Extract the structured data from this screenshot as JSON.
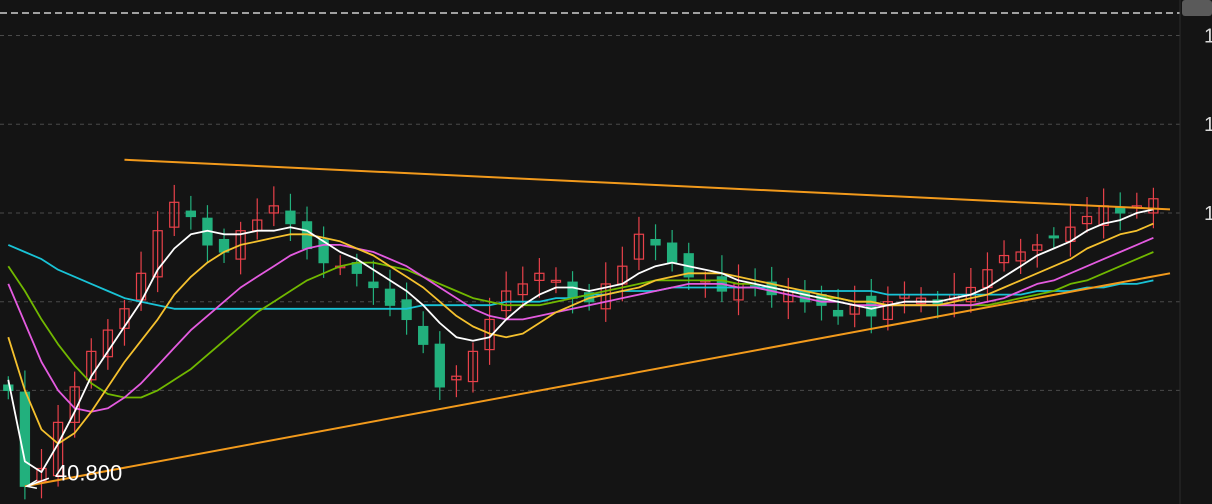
{
  "chart_data": {
    "type": "candlestick",
    "grid": true,
    "grid_style": "dashed",
    "ylim": [
      40.3,
      54.5
    ],
    "gridlines_y": [
      53.5,
      51.0,
      48.5,
      46.0,
      43.5
    ],
    "y_tick_labels": [
      {
        "y": 53.5,
        "text": "1"
      },
      {
        "y": 51.0,
        "text": "1"
      },
      {
        "y": 48.5,
        "text": "1"
      }
    ],
    "annotations": [
      {
        "type": "low_marker",
        "index": 1,
        "value": 40.8,
        "text": "40.800"
      }
    ],
    "trendlines": [
      {
        "name": "upper-resistance",
        "color": "#f29a1c",
        "from": {
          "x": 7,
          "y": 50.0
        },
        "to": {
          "x": 100,
          "y": 48.6
        }
      },
      {
        "name": "lower-support",
        "color": "#f29a1c",
        "from": {
          "x": 1,
          "y": 40.8
        },
        "to": {
          "x": 100,
          "y": 46.8
        }
      }
    ],
    "colors": {
      "up": "#e8414a",
      "down": "#22b07d",
      "background": "#141414",
      "grid": "#4a4a4a",
      "trend": "#f29a1c",
      "ma5": "#ffffff",
      "ma10": "#f5c12e",
      "ma20": "#e45be0",
      "ma30": "#71b800",
      "ma60": "#19c3d6"
    },
    "closes": [
      43.5,
      40.8,
      41.3,
      42.6,
      43.6,
      44.6,
      45.2,
      45.8,
      46.8,
      48.0,
      48.8,
      48.4,
      47.6,
      47.4,
      48.0,
      48.3,
      48.7,
      48.2,
      47.5,
      47.1,
      47.0,
      46.8,
      46.4,
      45.9,
      45.5,
      44.8,
      43.6,
      43.9,
      44.6,
      45.5,
      46.3,
      46.5,
      46.8,
      46.6,
      46.1,
      46.0,
      46.5,
      47.0,
      47.9,
      47.6,
      47.1,
      46.7,
      46.6,
      46.3,
      46.5,
      46.4,
      46.2,
      46.3,
      46.0,
      45.9,
      45.6,
      45.9,
      45.6,
      46.0,
      46.2,
      46.1,
      45.9,
      46.2,
      46.4,
      46.9,
      47.3,
      47.4,
      47.6,
      47.8,
      48.1,
      48.4,
      48.7,
      48.5,
      48.7,
      48.9
    ],
    "ma5": [
      43.8,
      41.5,
      41.2,
      42.0,
      42.9,
      43.9,
      44.6,
      45.3,
      46.0,
      46.9,
      47.5,
      47.9,
      48.0,
      47.9,
      47.9,
      48.0,
      48.0,
      48.1,
      48.0,
      47.7,
      47.4,
      47.2,
      46.9,
      46.6,
      46.3,
      45.9,
      45.4,
      45.0,
      44.9,
      45.0,
      45.5,
      45.9,
      46.2,
      46.4,
      46.4,
      46.3,
      46.4,
      46.5,
      46.8,
      47.0,
      47.1,
      47.0,
      46.9,
      46.8,
      46.6,
      46.5,
      46.4,
      46.3,
      46.2,
      46.1,
      46.0,
      45.9,
      45.8,
      45.9,
      46.0,
      46.0,
      46.0,
      46.1,
      46.2,
      46.4,
      46.7,
      47.0,
      47.3,
      47.5,
      47.7,
      48.0,
      48.2,
      48.3,
      48.5,
      48.6
    ],
    "ma10": [
      45.0,
      43.5,
      42.4,
      42.0,
      42.3,
      42.9,
      43.6,
      44.3,
      44.9,
      45.5,
      46.2,
      46.7,
      47.1,
      47.4,
      47.6,
      47.7,
      47.8,
      47.9,
      47.9,
      47.8,
      47.7,
      47.5,
      47.3,
      47.0,
      46.7,
      46.4,
      46.0,
      45.6,
      45.3,
      45.1,
      45.0,
      45.1,
      45.4,
      45.7,
      45.9,
      46.1,
      46.2,
      46.3,
      46.4,
      46.6,
      46.7,
      46.8,
      46.8,
      46.8,
      46.7,
      46.6,
      46.5,
      46.4,
      46.3,
      46.2,
      46.1,
      46.0,
      46.0,
      45.9,
      45.9,
      45.9,
      45.9,
      46.0,
      46.1,
      46.2,
      46.4,
      46.6,
      46.8,
      47.0,
      47.2,
      47.5,
      47.7,
      47.9,
      48.0,
      48.2
    ],
    "ma20": [
      46.5,
      45.4,
      44.3,
      43.5,
      43.0,
      42.9,
      43.0,
      43.3,
      43.7,
      44.2,
      44.7,
      45.2,
      45.6,
      46.0,
      46.4,
      46.7,
      47.0,
      47.3,
      47.5,
      47.6,
      47.6,
      47.5,
      47.4,
      47.2,
      47.0,
      46.7,
      46.4,
      46.1,
      45.8,
      45.6,
      45.5,
      45.5,
      45.6,
      45.7,
      45.8,
      45.9,
      46.0,
      46.1,
      46.2,
      46.3,
      46.4,
      46.5,
      46.5,
      46.5,
      46.4,
      46.4,
      46.3,
      46.2,
      46.1,
      46.0,
      46.0,
      45.9,
      45.9,
      45.9,
      45.9,
      45.9,
      45.9,
      45.9,
      45.9,
      46.0,
      46.1,
      46.3,
      46.5,
      46.6,
      46.8,
      47.0,
      47.2,
      47.4,
      47.6,
      47.8
    ],
    "ma30": [
      47.0,
      46.3,
      45.5,
      44.8,
      44.2,
      43.7,
      43.4,
      43.3,
      43.3,
      43.5,
      43.8,
      44.1,
      44.5,
      44.9,
      45.3,
      45.7,
      46.0,
      46.3,
      46.6,
      46.8,
      47.0,
      47.1,
      47.1,
      47.0,
      46.9,
      46.7,
      46.5,
      46.3,
      46.1,
      46.0,
      45.9,
      45.9,
      45.9,
      46.0,
      46.1,
      46.2,
      46.3,
      46.4,
      46.5,
      46.6,
      46.6,
      46.6,
      46.6,
      46.6,
      46.5,
      46.5,
      46.4,
      46.3,
      46.2,
      46.1,
      46.1,
      46.0,
      46.0,
      45.9,
      45.9,
      45.9,
      45.9,
      45.9,
      45.9,
      45.9,
      46.0,
      46.1,
      46.2,
      46.3,
      46.5,
      46.6,
      46.8,
      47.0,
      47.2,
      47.4
    ],
    "ma60": [
      47.6,
      47.4,
      47.2,
      46.9,
      46.7,
      46.5,
      46.3,
      46.1,
      46.0,
      45.9,
      45.8,
      45.8,
      45.8,
      45.8,
      45.8,
      45.8,
      45.8,
      45.8,
      45.8,
      45.8,
      45.8,
      45.8,
      45.8,
      45.8,
      45.8,
      45.9,
      45.9,
      45.9,
      45.9,
      45.9,
      46.0,
      46.0,
      46.0,
      46.1,
      46.1,
      46.2,
      46.2,
      46.3,
      46.3,
      46.3,
      46.4,
      46.4,
      46.4,
      46.4,
      46.4,
      46.4,
      46.4,
      46.3,
      46.3,
      46.3,
      46.3,
      46.3,
      46.3,
      46.2,
      46.2,
      46.2,
      46.2,
      46.2,
      46.2,
      46.2,
      46.2,
      46.2,
      46.3,
      46.3,
      46.3,
      46.4,
      46.4,
      46.5,
      46.5,
      46.6
    ]
  }
}
